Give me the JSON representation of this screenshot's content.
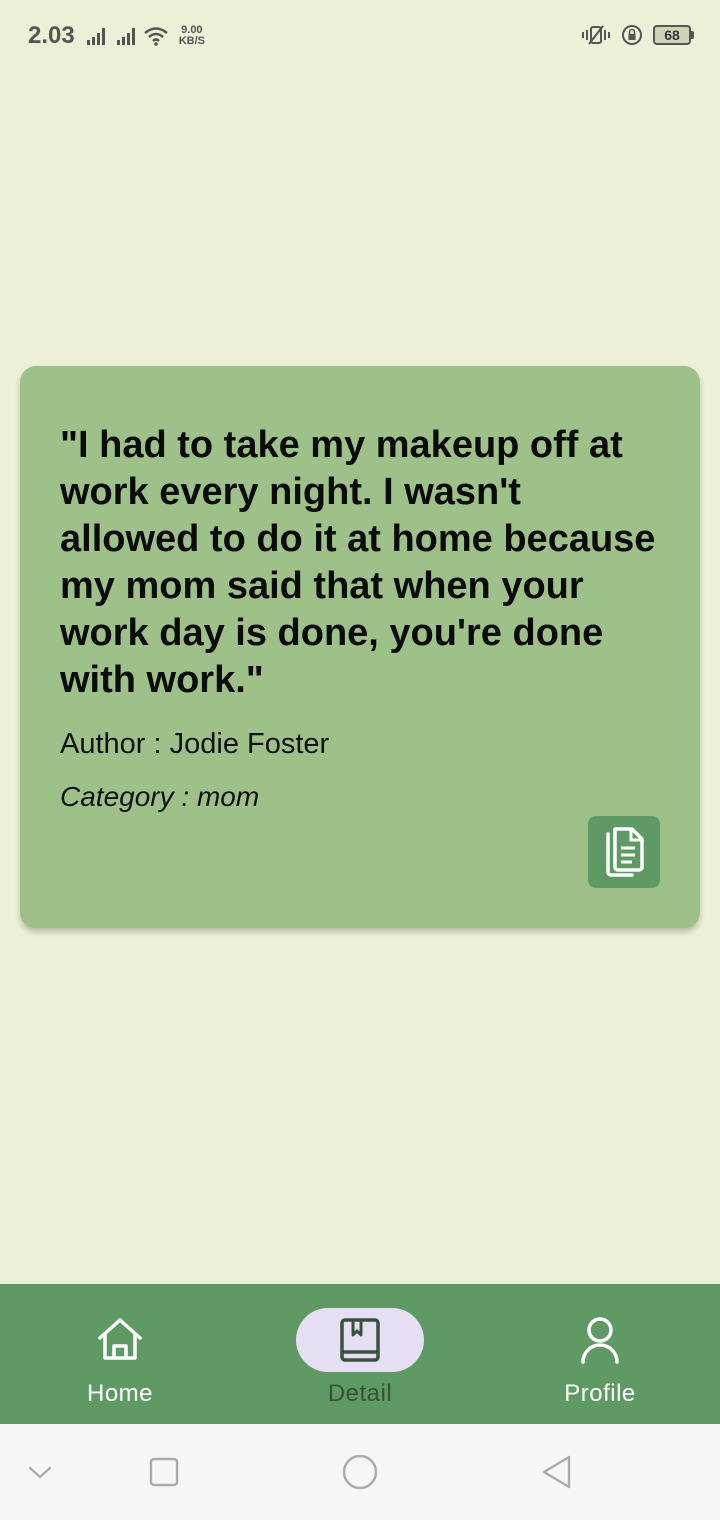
{
  "status_bar": {
    "time": "2.03",
    "net_speed_value": "9.00",
    "net_speed_unit": "KB/S",
    "battery_level": "68",
    "icons": [
      "signal-icon",
      "signal-icon",
      "wifi-icon",
      "vibrate-icon",
      "rotation-lock-icon",
      "battery-icon"
    ]
  },
  "quote": {
    "text": "\"I had to take my makeup off at work every night. I wasn't allowed to do it at home because my mom said that when your work day is done, you're done with work.\"",
    "author": "Author : Jodie Foster",
    "category": "Category : mom",
    "copy_icon": "copy-icon"
  },
  "bottom_nav": {
    "items": [
      {
        "label": "Home",
        "icon": "home-icon",
        "active": false
      },
      {
        "label": "Detail",
        "icon": "book-icon",
        "active": true
      },
      {
        "label": "Profile",
        "icon": "person-icon",
        "active": false
      }
    ]
  },
  "system_nav": {
    "icons": [
      "chevron-down-icon",
      "recents-icon",
      "home-circle-icon",
      "back-icon"
    ]
  },
  "colors": {
    "background": "#ecf0d6",
    "card": "#9ec18a",
    "accent": "#5f9963",
    "active_pill": "#e6dff3"
  }
}
